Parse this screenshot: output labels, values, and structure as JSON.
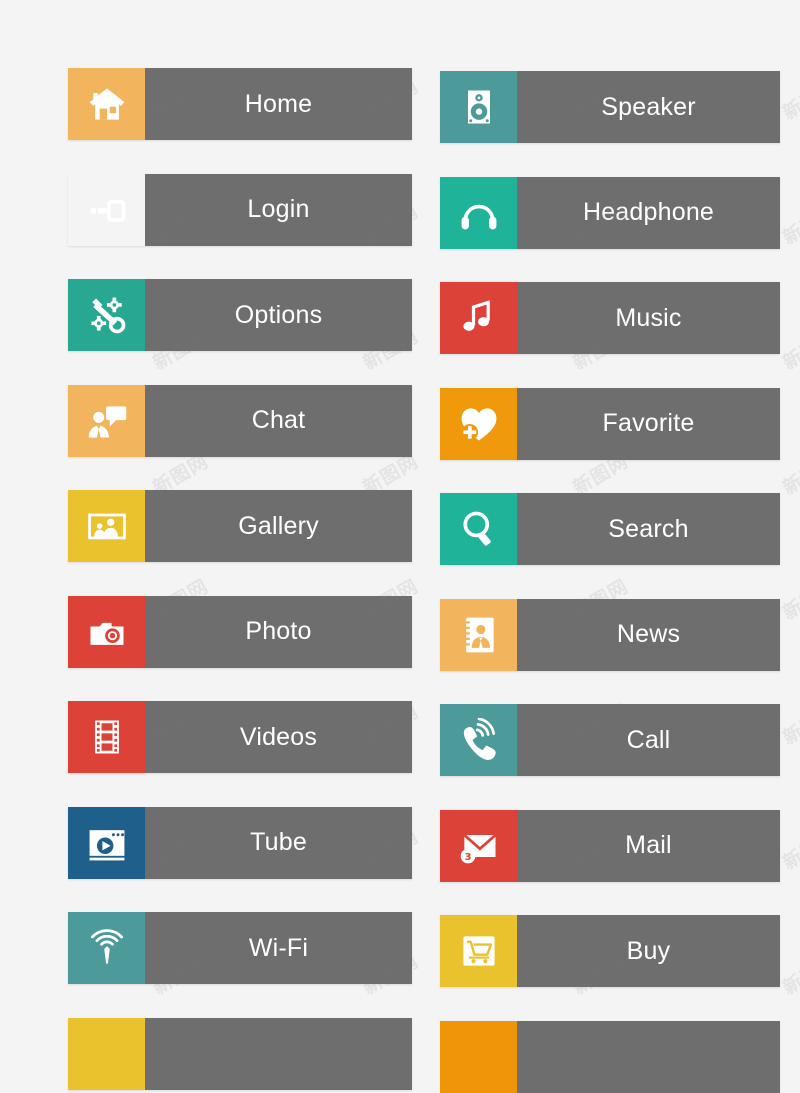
{
  "page": {
    "background_color": "#f4f4f4",
    "bar_color": "#6e6e6e",
    "label_color": "#ffffff",
    "watermark_text": "新图网"
  },
  "columns": {
    "left": {
      "buttons": [
        {
          "label": "Home",
          "icon": "house-icon",
          "color": "#f2b45c"
        },
        {
          "label": "Login",
          "icon": "key-icon",
          "color": "#eec githubE"
        },
        {
          "label": "Options",
          "icon": "wrench-gear-icon",
          "color": "#28a892"
        },
        {
          "label": "Chat",
          "icon": "person-speech-bubble-icon",
          "color": "#f2b45c"
        },
        {
          "label": "Gallery",
          "icon": "picture-frame-icon",
          "color": "#eac22e"
        },
        {
          "label": "Photo",
          "icon": "camera-icon",
          "color": "#dc4237"
        },
        {
          "label": "Videos",
          "icon": "film-strip-icon",
          "color": "#dc4237"
        },
        {
          "label": "Tube",
          "icon": "video-player-icon",
          "color": "#1e5f8c"
        },
        {
          "label": "Wi-Fi",
          "icon": "wifi-signal-icon",
          "color": "#4c9a9a"
        },
        {
          "label": "",
          "icon": "partial-icon",
          "color": "#eac22e"
        }
      ]
    },
    "right": {
      "buttons": [
        {
          "label": "Speaker",
          "icon": "speaker-icon",
          "color": "#4c9a9a"
        },
        {
          "label": "Headphone",
          "icon": "headphone-icon",
          "color": "#1fb39a"
        },
        {
          "label": "Music",
          "icon": "music-note-icon",
          "color": "#dc4237"
        },
        {
          "label": "Favorite",
          "icon": "heart-plus-icon",
          "color": "#f0990a"
        },
        {
          "label": "Search",
          "icon": "magnifier-icon",
          "color": "#1fb39a"
        },
        {
          "label": "News",
          "icon": "contact-book-icon",
          "color": "#f2b45c"
        },
        {
          "label": "Call",
          "icon": "phone-ringing-icon",
          "color": "#4c9a9a"
        },
        {
          "label": "Mail",
          "icon": "envelope-icon",
          "color": "#dc4237",
          "badge": "3"
        },
        {
          "label": "Buy",
          "icon": "shopping-cart-icon",
          "color": "#eac22e"
        },
        {
          "label": "",
          "icon": "partial-icon",
          "color": "#f0940a"
        }
      ]
    }
  }
}
